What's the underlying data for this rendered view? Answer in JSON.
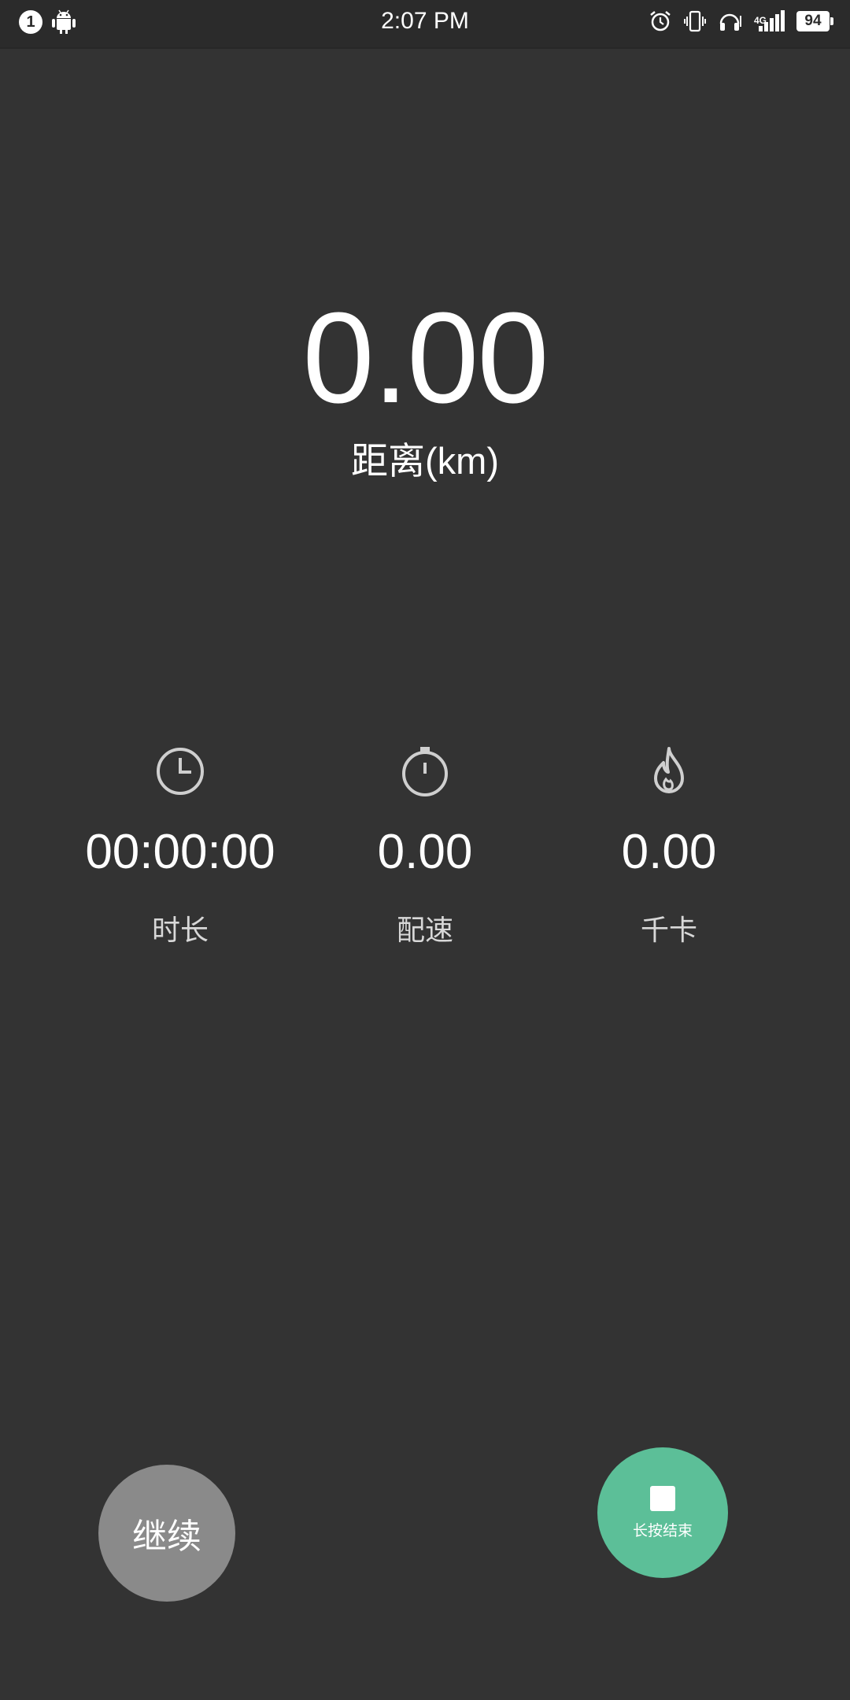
{
  "status_bar": {
    "notification_count": "1",
    "time": "2:07 PM",
    "network": "4G",
    "battery": "94",
    "icons": [
      "android-icon",
      "alarm-icon",
      "vibrate-icon",
      "headset-icon",
      "signal-icon",
      "battery-icon"
    ]
  },
  "distance": {
    "value": "0.00",
    "label": "距离(km)"
  },
  "stats": {
    "duration": {
      "icon": "clock-icon",
      "value": "00:00:00",
      "label": "时长"
    },
    "pace": {
      "icon": "stopwatch-icon",
      "value": "0.00",
      "label": "配速"
    },
    "calories": {
      "icon": "flame-icon",
      "value": "0.00",
      "label": "千卡"
    }
  },
  "actions": {
    "continue_label": "继续",
    "stop_label": "长按结束"
  },
  "colors": {
    "background": "#333333",
    "continue_button": "#8a8a8a",
    "stop_button": "#5cbf98"
  }
}
